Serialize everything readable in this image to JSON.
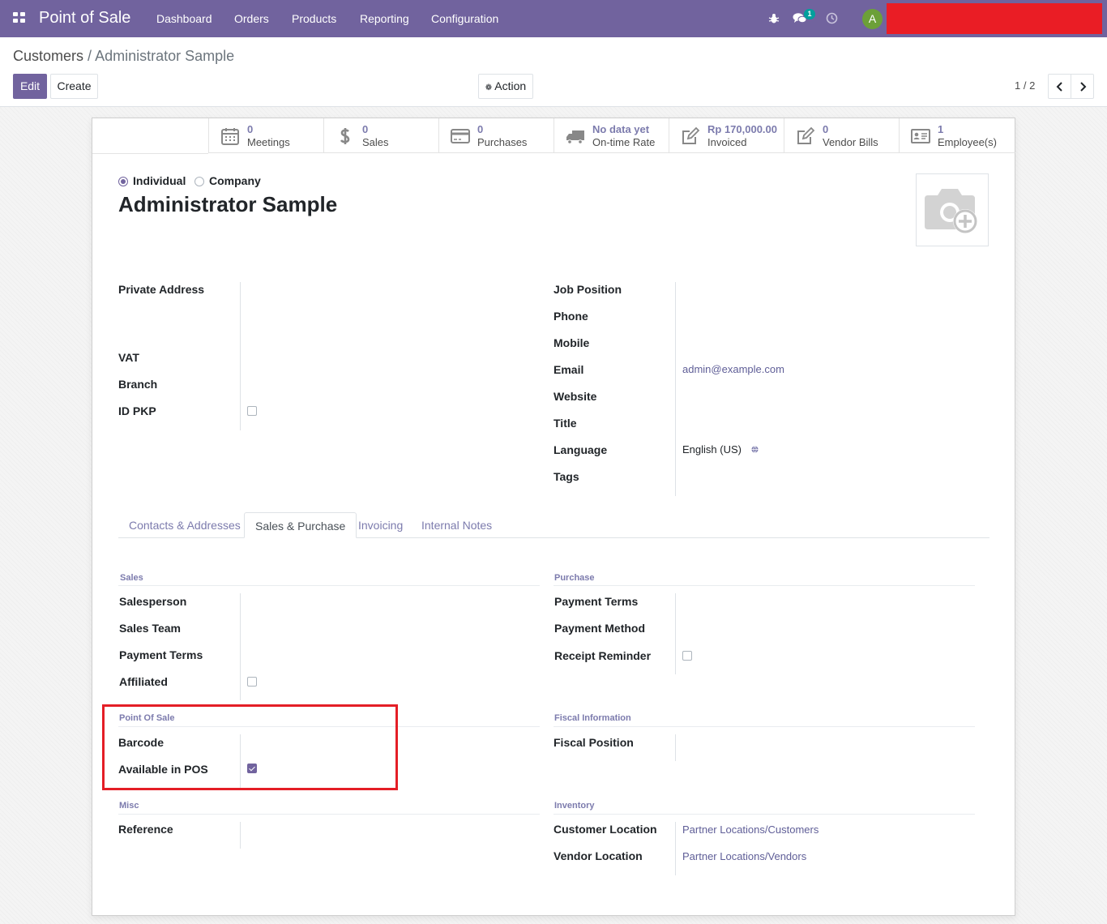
{
  "navbar": {
    "app_title": "Point of Sale",
    "menus": [
      "Dashboard",
      "Orders",
      "Products",
      "Reporting",
      "Configuration"
    ],
    "icons": [
      "apps-icon",
      "bug-icon",
      "chat-icon",
      "clock-icon"
    ],
    "messages_badge": "1",
    "avatar_letter": "A",
    "brand_color": "#71639e"
  },
  "breadcrumb": {
    "parent": "Customers",
    "separator": "/",
    "current": "Administrator Sample"
  },
  "toolbar": {
    "edit_label": "Edit",
    "create_label": "Create",
    "action_label": "Action",
    "pager": "1 / 2"
  },
  "stats": [
    {
      "value": "0",
      "label": "Meetings",
      "icon": "calendar-icon"
    },
    {
      "value": "0",
      "label": "Sales",
      "icon": "dollar-icon"
    },
    {
      "value": "0",
      "label": "Purchases",
      "icon": "credit-card-icon"
    },
    {
      "value": "No data yet",
      "label": "On-time Rate",
      "icon": "truck-icon"
    },
    {
      "value": "Rp 170,000.00",
      "label": "Invoiced",
      "icon": "edit-icon"
    },
    {
      "value": "0",
      "label": "Vendor Bills",
      "icon": "edit-icon"
    },
    {
      "value": "1",
      "label": "Employee(s)",
      "icon": "id-card-icon"
    }
  ],
  "partner": {
    "type_individual": "Individual",
    "type_company": "Company",
    "name": "Administrator Sample"
  },
  "left_fields": {
    "private_address": "Private Address",
    "vat": "VAT",
    "branch": "Branch",
    "id_pkp": "ID PKP"
  },
  "right_fields": {
    "job_position": "Job Position",
    "phone": "Phone",
    "mobile": "Mobile",
    "email": "Email",
    "email_value": "admin@example.com",
    "website": "Website",
    "title": "Title",
    "language": "Language",
    "language_value": "English (US)",
    "tags": "Tags"
  },
  "tabs": [
    "Contacts & Addresses",
    "Sales & Purchase",
    "Invoicing",
    "Internal Notes"
  ],
  "sales": {
    "title": "Sales",
    "salesperson": "Salesperson",
    "sales_team": "Sales Team",
    "payment_terms": "Payment Terms",
    "affiliated": "Affiliated"
  },
  "purchase": {
    "title": "Purchase",
    "payment_terms": "Payment Terms",
    "payment_method": "Payment Method",
    "receipt_reminder": "Receipt Reminder"
  },
  "pos": {
    "title": "Point Of Sale",
    "barcode": "Barcode",
    "available_in_pos": "Available in POS",
    "available_checked": true
  },
  "fiscal": {
    "title": "Fiscal Information",
    "fiscal_position": "Fiscal Position"
  },
  "misc": {
    "title": "Misc",
    "reference": "Reference"
  },
  "inventory": {
    "title": "Inventory",
    "customer_location": "Customer Location",
    "customer_location_value": "Partner Locations/Customers",
    "vendor_location": "Vendor Location",
    "vendor_location_value": "Partner Locations/Vendors"
  }
}
